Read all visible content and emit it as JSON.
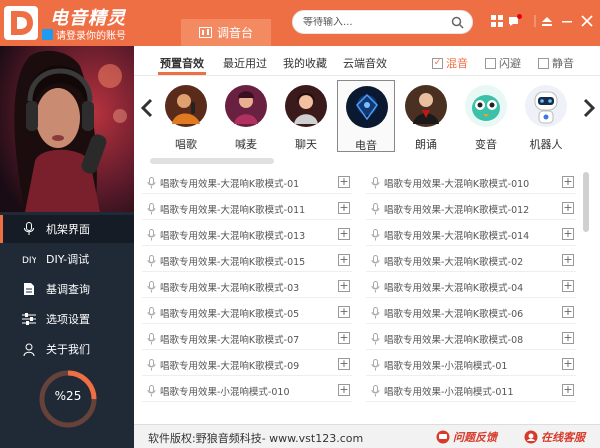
{
  "header": {
    "app_title": "电音精灵",
    "login_text": "请登录你的账号",
    "active_tab": "调音台",
    "search_placeholder": "等待输入..."
  },
  "sidebar": {
    "items": [
      {
        "label": "机架界面",
        "icon": "microphone-icon",
        "active": true
      },
      {
        "label": "DIY-调试",
        "icon": "diy-icon",
        "active": false
      },
      {
        "label": "基调查询",
        "icon": "document-icon",
        "active": false
      },
      {
        "label": "选项设置",
        "icon": "sliders-icon",
        "active": false
      },
      {
        "label": "关于我们",
        "icon": "user-icon",
        "active": false
      }
    ],
    "progress_label": "%25",
    "progress_value": 0.25
  },
  "tabs": [
    "预置音效",
    "最近用过",
    "我的收藏",
    "云端音效"
  ],
  "options": [
    {
      "label": "混音",
      "checked": true
    },
    {
      "label": "闪避",
      "checked": false
    },
    {
      "label": "静音",
      "checked": false
    }
  ],
  "scenes": [
    "唱歌",
    "喊麦",
    "聊天",
    "电音",
    "朗诵",
    "变音",
    "机器人"
  ],
  "effects": {
    "left": [
      "唱歌专用效果-大混响K歌模式-01",
      "唱歌专用效果-大混响K歌模式-011",
      "唱歌专用效果-大混响K歌模式-013",
      "唱歌专用效果-大混响K歌模式-015",
      "唱歌专用效果-大混响K歌模式-03",
      "唱歌专用效果-大混响K歌模式-05",
      "唱歌专用效果-大混响K歌模式-07",
      "唱歌专用效果-大混响K歌模式-09",
      "唱歌专用效果-小混响模式-010"
    ],
    "right": [
      "唱歌专用效果-大混响K歌模式-010",
      "唱歌专用效果-大混响K歌模式-012",
      "唱歌专用效果-大混响K歌模式-014",
      "唱歌专用效果-大混响K歌模式-02",
      "唱歌专用效果-大混响K歌模式-04",
      "唱歌专用效果-大混响K歌模式-06",
      "唱歌专用效果-大混响K歌模式-08",
      "唱歌专用效果-小混响模式-01",
      "唱歌专用效果-小混响模式-011"
    ]
  },
  "footer": {
    "copyright": "软件版权:野狼音频科技- www.vst123.com",
    "feedback": "问题反馈",
    "support": "在线客服"
  },
  "colors": {
    "accent": "#ef6f45",
    "sidebar": "#202a36",
    "link_red": "#d73a2a"
  }
}
